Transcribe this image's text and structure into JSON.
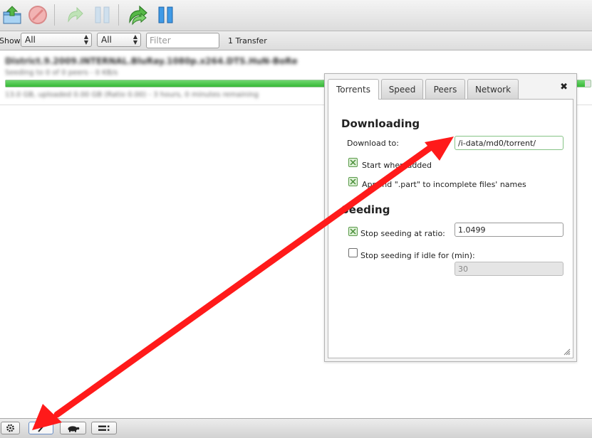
{
  "filterbar": {
    "show_label": "Show",
    "status_select": "All",
    "tracker_select": "All",
    "filter_placeholder": "Filter",
    "transfer_count": "1 Transfer"
  },
  "torrent": {
    "name": "District.9.2009.INTERNAL.BluRay.1080p.x264.DTS.HuN-BoRe",
    "peers": "Seeding to 0 of 0 peers - 0 KB/s",
    "progress": 0.99,
    "stats": "13.0 GB, uploaded 0.00 GB (Ratio 0.00) - 3 hours, 0 minutes remaining"
  },
  "dialog": {
    "tabs": [
      "Torrents",
      "Speed",
      "Peers",
      "Network"
    ],
    "active_tab": "Torrents",
    "close_symbol": "✖",
    "downloading": {
      "title": "Downloading",
      "download_to_label": "Download to:",
      "download_to_value": "/i-data/md0/torrent/",
      "start_when_added_label": "Start when added",
      "start_when_added": true,
      "append_part_label": "Append \".part\" to incomplete files' names",
      "append_part": true
    },
    "seeding": {
      "title": "Seeding",
      "stop_at_ratio_label": "Stop seeding at ratio:",
      "stop_at_ratio": true,
      "ratio_value": "1.0499",
      "stop_if_idle_label": "Stop seeding if idle for (min):",
      "stop_if_idle": false,
      "idle_value": "30"
    }
  },
  "colors": {
    "annotation_arrow": "#ff1a1a",
    "progress_green": "#36b836",
    "accent_blue": "#2a7fd0"
  },
  "icons": {
    "toolbar": [
      "open-torrent-icon",
      "remove-torrent-icon",
      "resume-torrent-icon",
      "pause-torrent-icon",
      "resume-all-icon",
      "pause-all-icon"
    ],
    "bottombar": [
      "gear-icon",
      "compact-view-icon",
      "turtle-icon",
      "details-list-icon"
    ]
  }
}
